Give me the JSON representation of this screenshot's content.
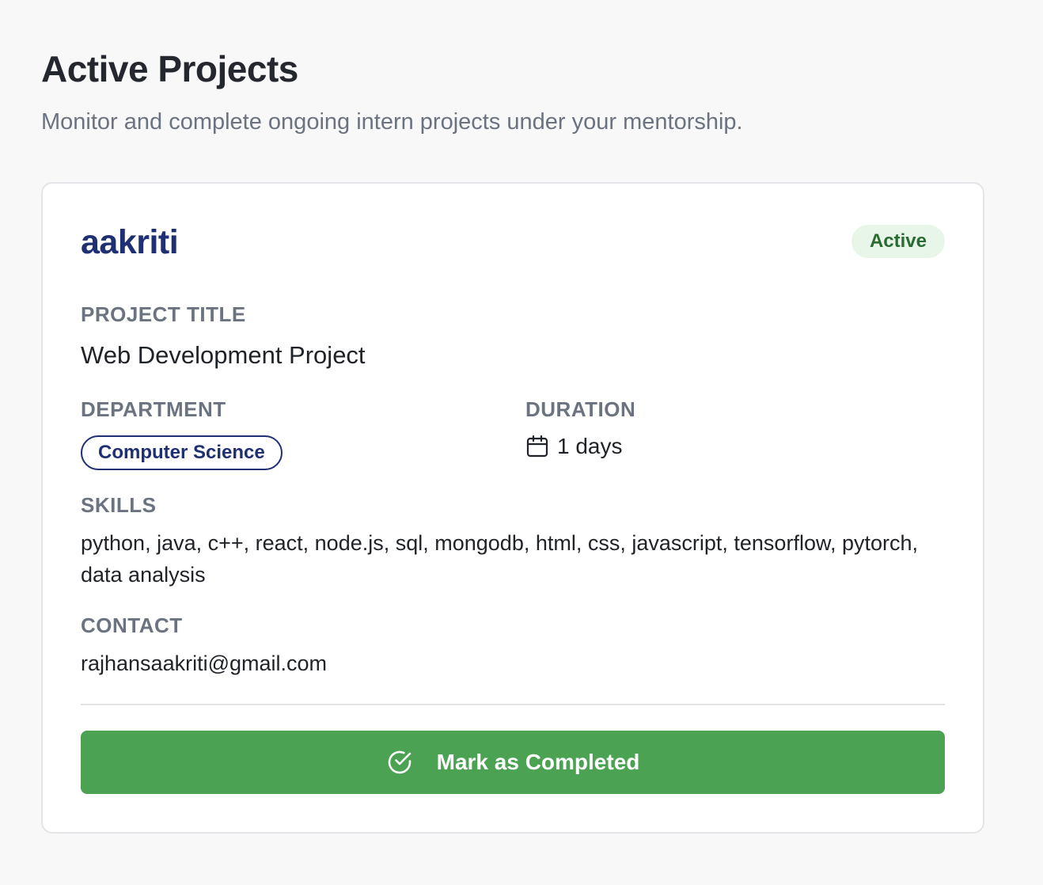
{
  "header": {
    "title": "Active Projects",
    "subtitle": "Monitor and complete ongoing intern projects under your mentorship."
  },
  "project": {
    "intern_name": "aakriti",
    "status": "Active",
    "project_title_label": "PROJECT TITLE",
    "project_title": "Web Development Project",
    "department_label": "DEPARTMENT",
    "department": "Computer Science",
    "duration_label": "DURATION",
    "duration": "1 days",
    "skills_label": "SKILLS",
    "skills": "python, java, c++, react, node.js, sql, mongodb, html, css, javascript, tensorflow, pytorch, data analysis",
    "contact_label": "CONTACT",
    "contact": "rajhansaakriti@gmail.com",
    "complete_button_label": "Mark as Completed"
  },
  "icons": {
    "duration_icon": "calendar-icon",
    "complete_icon": "check-circle-icon"
  },
  "colors": {
    "accent_navy": "#1f2f73",
    "status_green_bg": "#e7f6e9",
    "status_green_text": "#2a6b31",
    "button_green": "#4ba253"
  }
}
